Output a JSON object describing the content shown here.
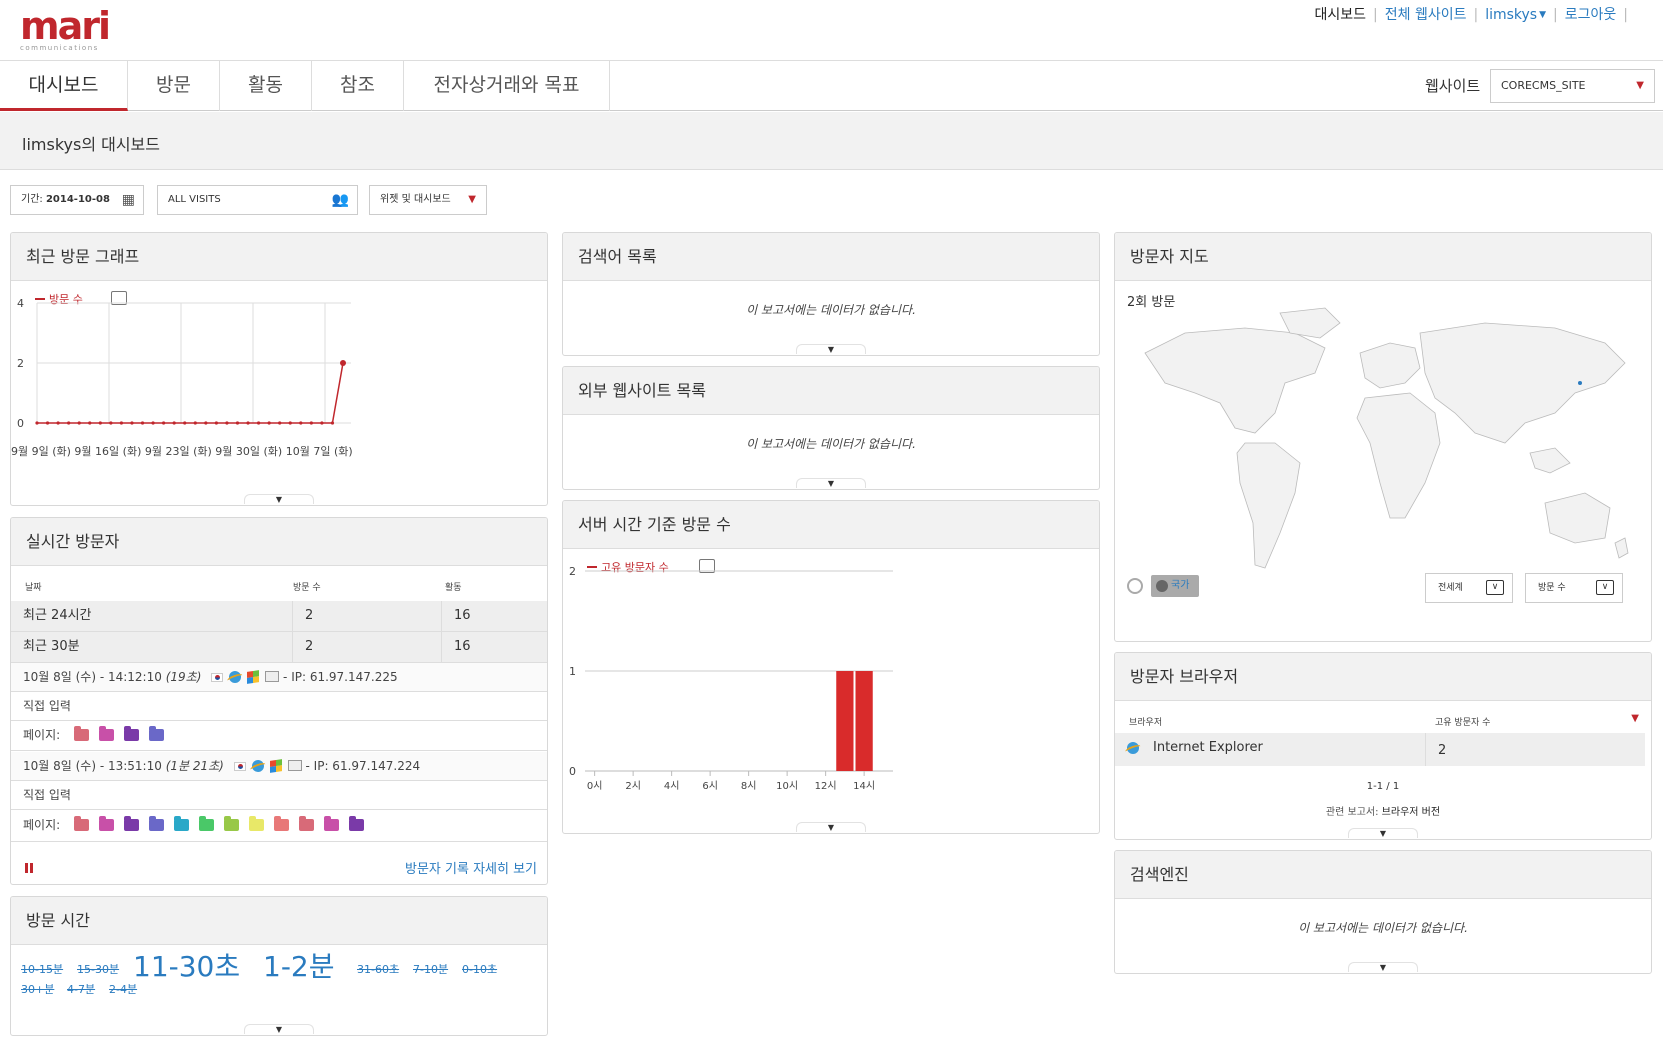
{
  "header": {
    "logo_text": "mari",
    "logo_sub": "communications",
    "links": [
      "대시보드",
      "전체 웹사이트",
      "limskys",
      "로그아웃"
    ]
  },
  "nav": {
    "tabs": [
      "대시보드",
      "방문",
      "활동",
      "참조",
      "전자상거래와 목표"
    ],
    "site_label": "웹사이트",
    "site_value": "CORECMS_SITE"
  },
  "page_title": "limskys의 대시보드",
  "controls": {
    "period_label": "기간:",
    "period_value": "2014-10-08",
    "segment": "ALL VISITS",
    "widget_menu": "위젯 및 대시보드"
  },
  "widgets": {
    "visits_graph": {
      "title": "최근 방문 그래프",
      "legend": "방문 수",
      "x_labels": "9월 9일 (화)   9월 16일 (화)  9월 23일 (화)  9월 30일 (화)  10월 7일 (화)",
      "y_ticks": [
        "4",
        "2",
        "0"
      ]
    },
    "realtime": {
      "title": "실시간 방문자",
      "columns": [
        "날짜",
        "방문 수",
        "활동"
      ],
      "rows": [
        {
          "label": "최근 24시간",
          "visits": "2",
          "actions": "16"
        },
        {
          "label": "최근 30분",
          "visits": "2",
          "actions": "16"
        }
      ],
      "visit1": {
        "time": "10월 8일 (수) - 14:12:10",
        "ago": "(19초)",
        "ip": "- IP: 61.97.147.225",
        "ref": "직접 입력",
        "pages_label": "페이지:"
      },
      "visit2": {
        "time": "10월 8일 (수) - 13:51:10",
        "ago": "(1분 21초)",
        "ip": "- IP: 61.97.147.224",
        "ref": "직접 입력",
        "pages_label": "페이지:"
      },
      "more_link": "방문자 기록 자세히 보기"
    },
    "visit_duration": {
      "title": "방문 시간",
      "tags": [
        "10-15분",
        "15-30분",
        "11-30초",
        "1-2분",
        "31-60초",
        "7-10분",
        "0-10초",
        "30+분",
        "4-7분",
        "2-4분"
      ]
    },
    "keywords": {
      "title": "검색어 목록",
      "nodata": "이 보고서에는 데이터가 없습니다."
    },
    "websites": {
      "title": "외부 웹사이트 목록",
      "nodata": "이 보고서에는 데이터가 없습니다."
    },
    "server_time": {
      "title": "서버 시간 기준 방문 수",
      "legend": "고유 방문자 수",
      "y_ticks": [
        "2",
        "1",
        "0"
      ],
      "x_ticks": [
        "0시",
        "2시",
        "4시",
        "6시",
        "8시",
        "10시",
        "12시",
        "14시"
      ]
    },
    "map": {
      "title": "방문자 지도",
      "count": "2회 방문",
      "country_btn": "국가",
      "region_select": "전세계",
      "metric_select": "방문 수"
    },
    "browsers": {
      "title": "방문자 브라우저",
      "columns": [
        "브라우저",
        "고유 방문자 수"
      ],
      "row": {
        "name": "Internet Explorer",
        "value": "2"
      },
      "pager": "1-1 / 1",
      "related_label": "관련 보고서:",
      "related_link": "브라우저 버전"
    },
    "search_engines": {
      "title": "검색엔진",
      "nodata": "이 보고서에는 데이터가 없습니다."
    }
  },
  "chart_data": [
    {
      "type": "line",
      "title": "최근 방문 그래프",
      "series": [
        {
          "name": "방문 수",
          "values": [
            0,
            0,
            0,
            0,
            0,
            0,
            0,
            0,
            0,
            0,
            0,
            0,
            0,
            0,
            0,
            0,
            0,
            0,
            0,
            0,
            0,
            0,
            0,
            0,
            0,
            0,
            0,
            0,
            0,
            2
          ]
        }
      ],
      "ylim": [
        0,
        4
      ]
    },
    {
      "type": "bar",
      "title": "서버 시간 기준 방문 수",
      "categories": [
        "0시",
        "1시",
        "2시",
        "3시",
        "4시",
        "5시",
        "6시",
        "7시",
        "8시",
        "9시",
        "10시",
        "11시",
        "12시",
        "13시",
        "14시",
        "15시"
      ],
      "series": [
        {
          "name": "고유 방문자 수",
          "values": [
            0,
            0,
            0,
            0,
            0,
            0,
            0,
            0,
            0,
            0,
            0,
            0,
            0,
            1,
            1,
            0
          ]
        }
      ],
      "ylim": [
        0,
        2
      ]
    }
  ]
}
